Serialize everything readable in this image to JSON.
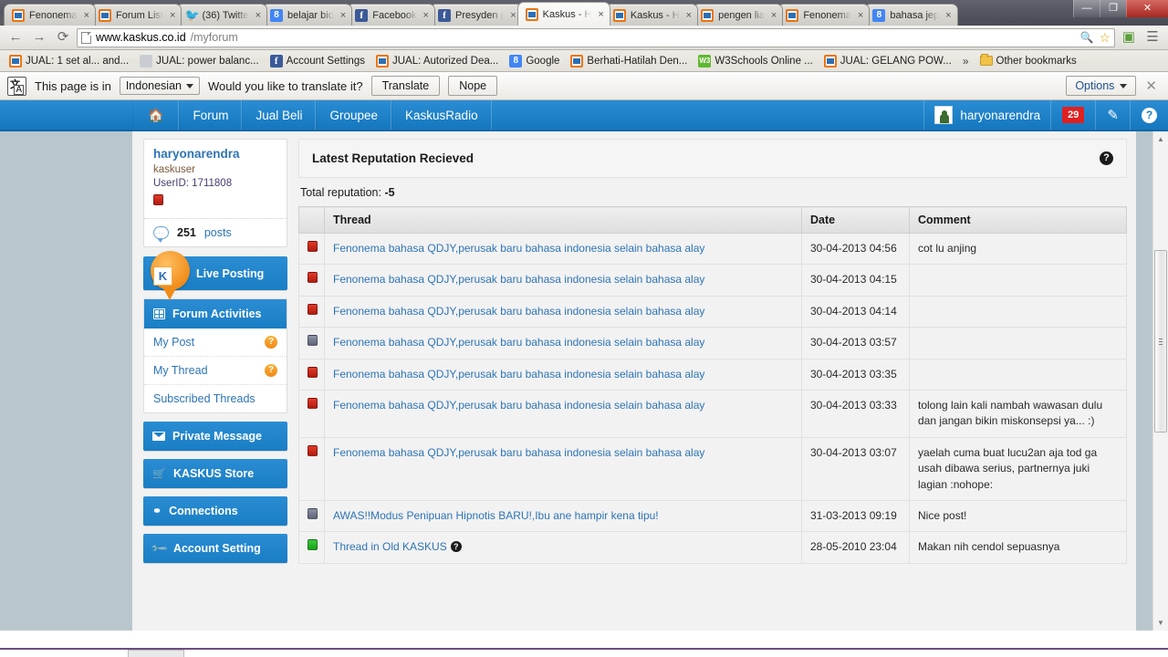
{
  "browser": {
    "tabs": [
      {
        "label": "Fenonema",
        "favicon": "kaskus-icon",
        "active": false
      },
      {
        "label": "Forum List",
        "favicon": "kaskus-icon",
        "active": false
      },
      {
        "label": "(36) Twitte",
        "favicon": "twitter-icon",
        "active": false
      },
      {
        "label": "belajar bio",
        "favicon": "google-icon",
        "active": false
      },
      {
        "label": "Facebook",
        "favicon": "facebook-icon",
        "active": false
      },
      {
        "label": "Presyden (",
        "favicon": "facebook-icon",
        "active": false
      },
      {
        "label": "Kaskus - H",
        "favicon": "kaskus-icon",
        "active": true
      },
      {
        "label": "Kaskus - H",
        "favicon": "kaskus-icon",
        "active": false
      },
      {
        "label": "pengen lia",
        "favicon": "kaskus-icon",
        "active": false
      },
      {
        "label": "Fenonema",
        "favicon": "kaskus-icon",
        "active": false
      },
      {
        "label": "bahasa jep",
        "favicon": "google-icon",
        "active": false
      }
    ],
    "tab_close_label": "×",
    "window_controls": {
      "minimize": "—",
      "restore": "❐",
      "close": "✕"
    },
    "nav": {
      "back": "←",
      "forward": "→",
      "reload": "⟳"
    },
    "url": {
      "strong": "www.kaskus.co.id",
      "dim": "/myforum"
    },
    "url_actions": {
      "zoom": "🔍",
      "star": "☆",
      "extension": "▣",
      "menu": "☰"
    },
    "bookmarks": [
      {
        "label": "JUAL: 1 set al... and...",
        "favicon": "kaskus-icon"
      },
      {
        "label": "JUAL: power balanc...",
        "favicon": "generic-icon"
      },
      {
        "label": "Account Settings",
        "favicon": "facebook-icon"
      },
      {
        "label": "JUAL: Autorized Dea...",
        "favicon": "kaskus-icon"
      },
      {
        "label": "Google",
        "favicon": "google-icon"
      },
      {
        "label": "Berhati-Hatilah Den...",
        "favicon": "kaskus-icon"
      },
      {
        "label": "W3Schools Online ...",
        "favicon": "w3schools-icon"
      },
      {
        "label": "JUAL: GELANG POW...",
        "favicon": "kaskus-icon"
      }
    ],
    "bookmarks_overflow": "»",
    "other_bookmarks": "Other bookmarks"
  },
  "translate_bar": {
    "message_prefix": "This page is in",
    "language": "Indonesian",
    "message_suffix": "Would you like to translate it?",
    "translate_label": "Translate",
    "nope_label": "Nope",
    "options_label": "Options",
    "close_label": "✕"
  },
  "site_nav": {
    "home_icon": "🏠",
    "items": [
      "Forum",
      "Jual Beli",
      "Groupee",
      "KaskusRadio"
    ],
    "username": "haryonarendra",
    "badge_count": "29",
    "compose_icon": "✎",
    "help_icon": "?"
  },
  "sidebar": {
    "profile": {
      "username": "haryonarendra",
      "role": "kaskuser",
      "userid": "UserID: 1711808",
      "reputation_color": "#c32b19",
      "post_count": "251",
      "post_label": "posts"
    },
    "live_posting": "Live Posting",
    "forum_activities": {
      "title": "Forum Activities",
      "items": [
        {
          "label": "My Post",
          "badge": "?"
        },
        {
          "label": "My Thread",
          "badge": "?"
        },
        {
          "label": "Subscribed Threads",
          "badge": ""
        }
      ]
    },
    "buttons": [
      {
        "label": "Private Message",
        "icon": "envelope-icon"
      },
      {
        "label": "KASKUS Store",
        "icon": "cart-icon"
      },
      {
        "label": "Connections",
        "icon": "connections-icon"
      },
      {
        "label": "Account Setting",
        "icon": "wrench-icon"
      }
    ]
  },
  "main": {
    "section_title": "Latest Reputation Recieved",
    "help_icon": "?",
    "total_reputation_label": "Total reputation:",
    "total_reputation_value": "-5",
    "table": {
      "headers": [
        "Thread",
        "Date",
        "Comment"
      ],
      "rows": [
        {
          "rep": "red",
          "thread": "Fenonema bahasa QDJY,perusak baru bahasa indonesia selain bahasa alay",
          "date": "30-04-2013 04:56",
          "comment": "cot lu anjing",
          "help": false
        },
        {
          "rep": "red",
          "thread": "Fenonema bahasa QDJY,perusak baru bahasa indonesia selain bahasa alay",
          "date": "30-04-2013 04:15",
          "comment": "",
          "help": false
        },
        {
          "rep": "red",
          "thread": "Fenonema bahasa QDJY,perusak baru bahasa indonesia selain bahasa alay",
          "date": "30-04-2013 04:14",
          "comment": "",
          "help": false
        },
        {
          "rep": "gray",
          "thread": "Fenonema bahasa QDJY,perusak baru bahasa indonesia selain bahasa alay",
          "date": "30-04-2013 03:57",
          "comment": "",
          "help": false
        },
        {
          "rep": "red",
          "thread": "Fenonema bahasa QDJY,perusak baru bahasa indonesia selain bahasa alay",
          "date": "30-04-2013 03:35",
          "comment": "",
          "help": false
        },
        {
          "rep": "red",
          "thread": "Fenonema bahasa QDJY,perusak baru bahasa indonesia selain bahasa alay",
          "date": "30-04-2013 03:33",
          "comment": "tolong lain kali nambah wawasan dulu dan jangan bikin miskonsepsi ya... :)",
          "help": false
        },
        {
          "rep": "red",
          "thread": "Fenonema bahasa QDJY,perusak baru bahasa indonesia selain bahasa alay",
          "date": "30-04-2013 03:07",
          "comment": "yaelah cuma buat lucu2an aja tod ga usah dibawa serius, partnernya juki lagian :nohope:",
          "help": false
        },
        {
          "rep": "gray",
          "thread": "AWAS!!Modus Penipuan Hipnotis BARU!,Ibu ane hampir kena tipu!",
          "date": "31-03-2013 09:19",
          "comment": "Nice post!",
          "help": false
        },
        {
          "rep": "green",
          "thread": "Thread in Old KASKUS",
          "date": "28-05-2010 23:04",
          "comment": "Makan nih cendol sepuasnya",
          "help": true
        }
      ]
    }
  },
  "colors": {
    "brand_blue": "#1a7ec4",
    "link_blue": "#2e74b5",
    "badge_red": "#e02020",
    "rep_red": "#c32b19",
    "rep_gray": "#6e7487",
    "rep_green": "#22b522",
    "page_bg": "#b9c7cd"
  }
}
